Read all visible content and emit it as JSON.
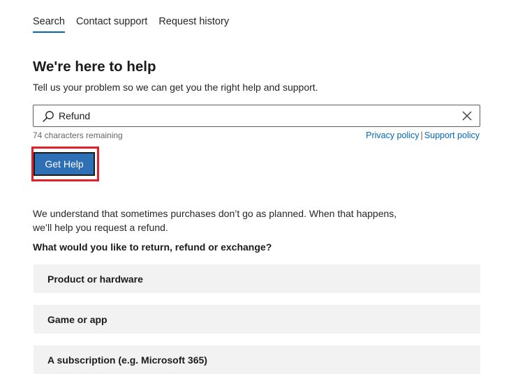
{
  "tabs": [
    {
      "label": "Search",
      "active": true
    },
    {
      "label": "Contact support",
      "active": false
    },
    {
      "label": "Request history",
      "active": false
    }
  ],
  "header": {
    "title": "We're here to help",
    "subtitle": "Tell us your problem so we can get you the right help and support."
  },
  "search": {
    "value": "Refund",
    "icon": "search-icon",
    "clear_icon": "close-icon",
    "char_count": "74 characters remaining"
  },
  "links": {
    "privacy": "Privacy policy",
    "separator": "|",
    "support": "Support policy"
  },
  "button": {
    "label": "Get Help"
  },
  "content": {
    "intro": "We understand that sometimes purchases don’t go as planned. When that happens, we’ll help you request a refund.",
    "question": "What would you like to return, refund or exchange?",
    "options": [
      {
        "label": "Product or hardware"
      },
      {
        "label": "Game or app"
      },
      {
        "label": "A subscription (e.g. Microsoft 365)"
      }
    ]
  },
  "colors": {
    "accent": "#0067b8",
    "button_bg": "#2f6fb5",
    "highlight": "#e3202a",
    "option_bg": "#f2f2f2"
  }
}
